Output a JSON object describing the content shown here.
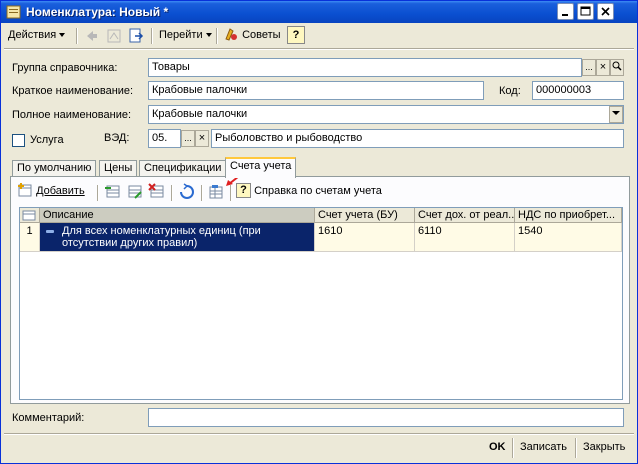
{
  "window": {
    "title": "Номенклатура: Новый *"
  },
  "toolbar": {
    "actions_label": "Действия",
    "goto_label": "Перейти",
    "tips_label": "Советы",
    "help_label": "?"
  },
  "form": {
    "group_label": "Группа справочника:",
    "group_value": "Товары",
    "short_name_label": "Краткое наименование:",
    "short_name_value": "Крабовые палочки",
    "code_label": "Код:",
    "code_value": "000000003",
    "full_name_label": "Полное наименование:",
    "full_name_value": "Крабовые палочки",
    "service_label": "Услуга",
    "ved_label": "ВЭД:",
    "ved_code": "05.",
    "ved_name": "Рыболовство и рыбоводство",
    "select_glyph": "...",
    "clear_glyph": "×"
  },
  "tabs": [
    {
      "label": "По умолчанию"
    },
    {
      "label": "Цены"
    },
    {
      "label": "Спецификации"
    },
    {
      "label": "Счета учета"
    }
  ],
  "tab_toolbar": {
    "add_label": "Добавить",
    "help_accounts_label": "Справка по счетам учета",
    "help_glyph": "?"
  },
  "grid": {
    "columns": [
      "Описание",
      "Счет учета (БУ)",
      "Счет дох. от реал...",
      "НДС по приобрет..."
    ],
    "rows": [
      {
        "num": "1",
        "description": "Для всех номенклатурных единиц (при отсутствии других правил)",
        "account_bu": "1610",
        "income_account": "6110",
        "vat_account": "1540"
      }
    ]
  },
  "comment": {
    "label": "Комментарий:",
    "value": ""
  },
  "bottom": {
    "ok_label": "OK",
    "save_label": "Записать",
    "close_label": "Закрыть"
  },
  "colors": {
    "titlebar": "#0a4fd0",
    "selection": "#0a246a",
    "active_tab_accent": "#ffc83c",
    "arrow_annotation": "#e02020"
  }
}
